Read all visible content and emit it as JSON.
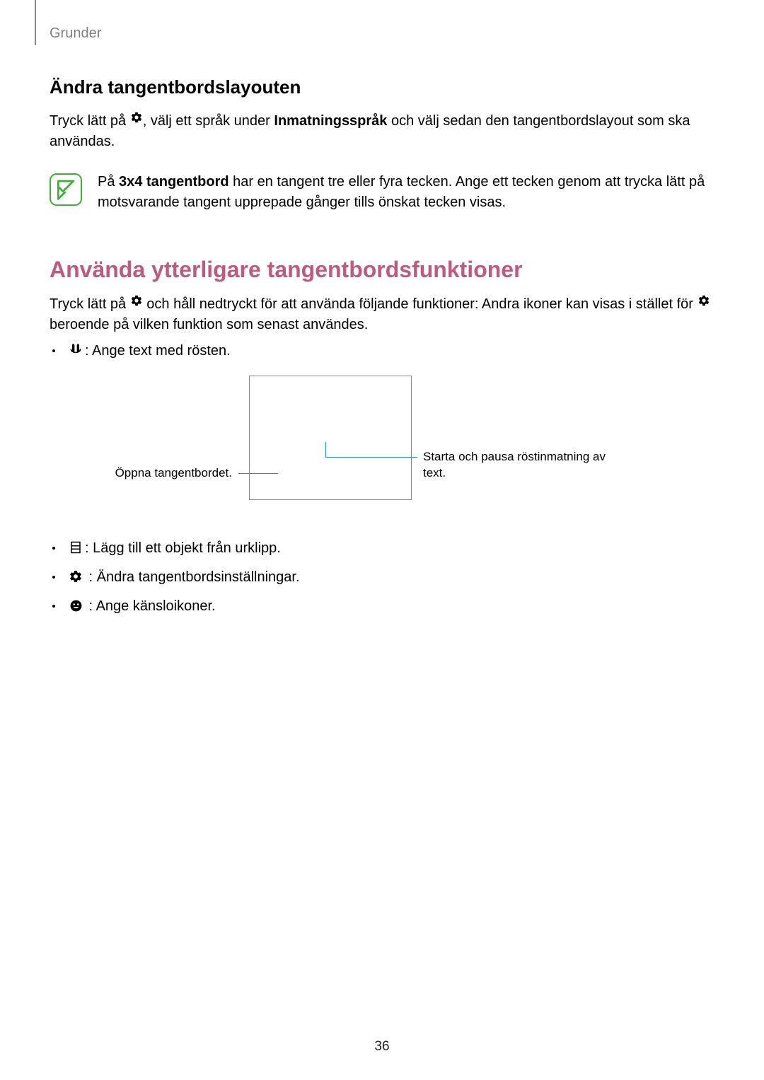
{
  "header": "Grunder",
  "section1": {
    "heading": "Ändra tangentbordslayouten",
    "para_pre": "Tryck lätt på ",
    "para_post": ", välj ett språk under ",
    "para_bold": "Inmatningsspråk",
    "para_after": " och välj sedan den tangentbordslayout som ska användas.",
    "note_pre": "På ",
    "note_bold": "3x4 tangentbord",
    "note_after": " har en tangent tre eller fyra tecken. Ange ett tecken genom att trycka lätt på motsvarande tangent upprepade gånger tills önskat tecken visas."
  },
  "section2": {
    "heading": "Använda ytterligare tangentbordsfunktioner",
    "para_pre": "Tryck lätt på ",
    "para_mid": " och håll nedtryckt för att använda följande funktioner: Andra ikoner kan visas i stället för ",
    "para_after": " beroende på vilken funktion som senast användes.",
    "bullets": {
      "b1": ": Ange text med rösten.",
      "b2": ": Lägg till ett objekt från urklipp.",
      "b3": " : Ändra tangentbordsinställningar.",
      "b4": " : Ange känsloikoner."
    },
    "diagram": {
      "left": "Öppna tangentbordet.",
      "right": "Starta och pausa röstinmatning av text."
    }
  },
  "page_number": "36"
}
